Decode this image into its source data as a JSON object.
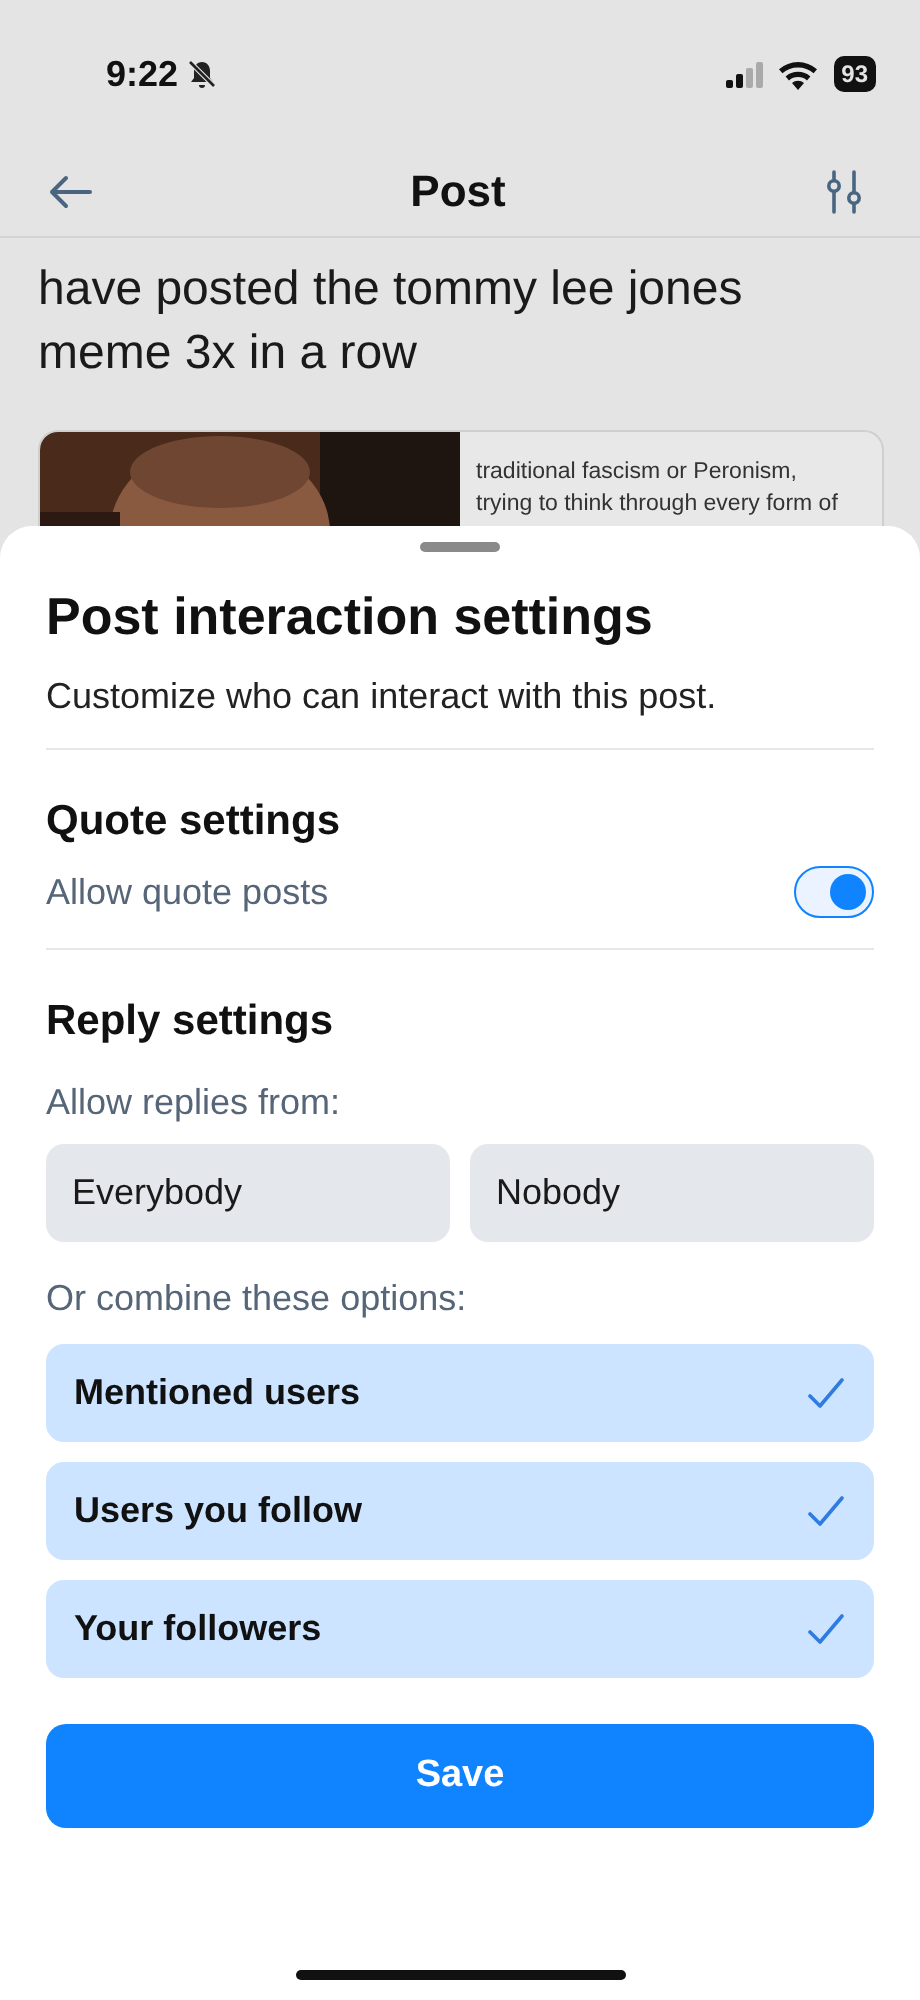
{
  "status_bar": {
    "time": "9:22",
    "battery": "93"
  },
  "header": {
    "title": "Post"
  },
  "post": {
    "lines": [
      "have posted the tommy lee jones",
      "meme 3x in a row"
    ],
    "quote_card": {
      "excerpt": [
        "traditional fascism or Peronism,",
        "trying to think through every form of"
      ]
    }
  },
  "sheet": {
    "title": "Post interaction settings",
    "subtitle": "Customize who can interact with this post.",
    "quote_settings": {
      "heading": "Quote settings",
      "label": "Allow quote posts",
      "on": true
    },
    "reply_settings": {
      "heading": "Reply settings",
      "label": "Allow replies from:",
      "choices": [
        {
          "label": "Everybody",
          "selected": false
        },
        {
          "label": "Nobody",
          "selected": false
        }
      ],
      "combine_label": "Or combine these options:",
      "options": [
        {
          "label": "Mentioned users",
          "checked": true
        },
        {
          "label": "Users you follow",
          "checked": true
        },
        {
          "label": "Your followers",
          "checked": true
        }
      ]
    },
    "save": "Save"
  }
}
